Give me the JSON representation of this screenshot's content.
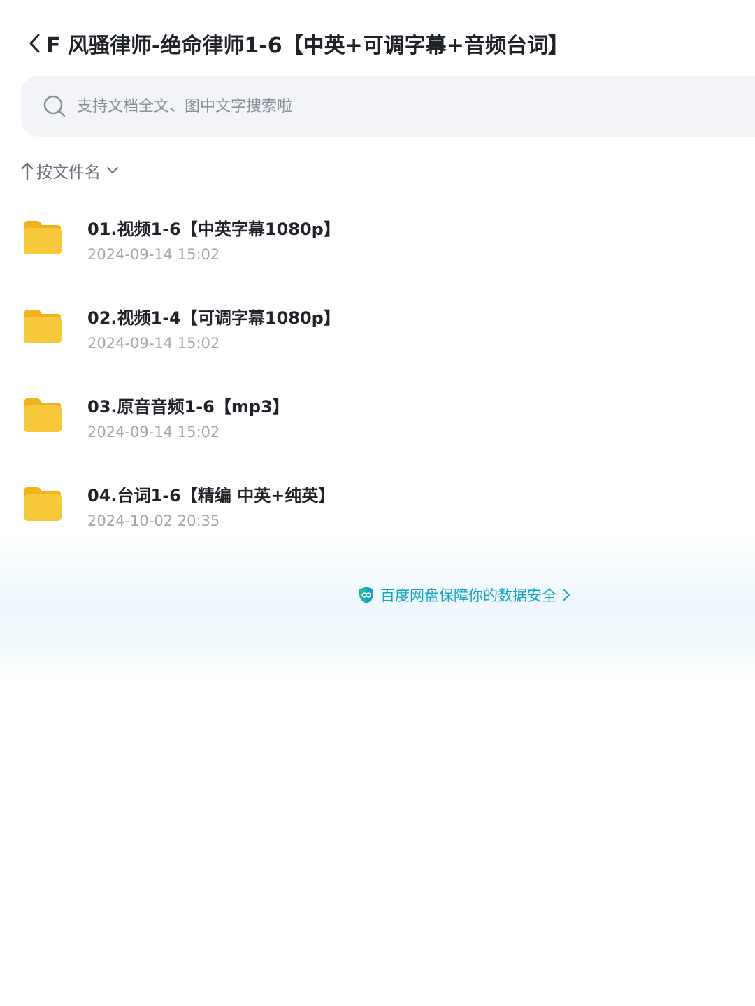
{
  "header": {
    "back_label": "<",
    "title": "F 风骚律师-绝命律师1-6【中英+可调字幕+音频台词】"
  },
  "search": {
    "placeholder": "支持文档全文、图中文字搜索啦",
    "value": ""
  },
  "sort": {
    "label": "按文件名",
    "direction": "ascending"
  },
  "files": [
    {
      "name": "01.视频1-6【中英字幕1080p】",
      "date": "2024-09-14 15:02",
      "icon": "folder-icon"
    },
    {
      "name": "02.视频1-4【可调字幕1080p】",
      "date": "2024-09-14 15:02",
      "icon": "folder-icon"
    },
    {
      "name": "03.原音音频1-6【mp3】",
      "date": "2024-09-14 15:02",
      "icon": "folder-icon"
    },
    {
      "name": "04.台词1-6【精编 中英+纯英】",
      "date": "2024-10-02 20:35",
      "icon": "folder-icon"
    }
  ],
  "footer": {
    "security_text": "百度网盘保障你的数据安全"
  },
  "colors": {
    "accent": "#14a3c7",
    "folder": "#f7c83a",
    "folder_tab": "#f2b21c",
    "search_bg": "#f2f4f8"
  }
}
